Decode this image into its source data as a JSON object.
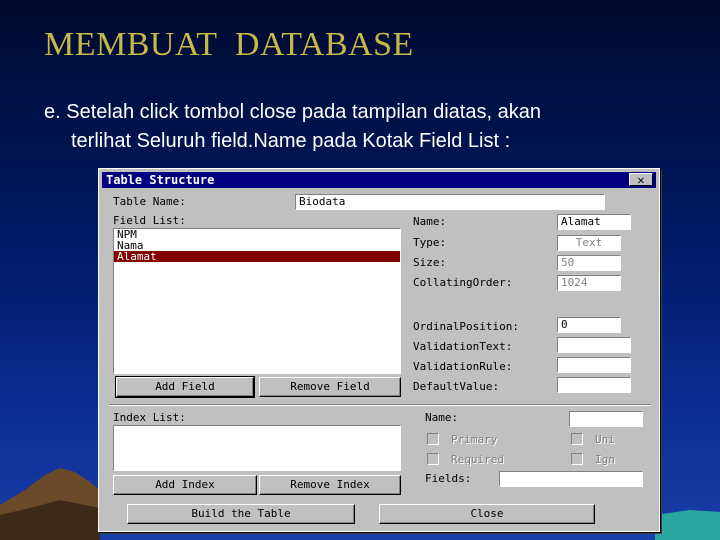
{
  "slide": {
    "title": "MEMBUAT  DATABASE",
    "text_line1": "e. Setelah click tombol close pada tampilan diatas, akan",
    "text_line2": "terlihat Seluruh field.Name pada Kotak Field List  :"
  },
  "dialog": {
    "title": "Table Structure",
    "close_glyph": "✕",
    "table_name_label": "Table Name:",
    "table_name_value": "Biodata",
    "field_list_label": "Field List:",
    "fields": [
      "NPM",
      "Nama",
      "Alamat"
    ],
    "selected_field_index": 2,
    "props": {
      "name_label": "Name:",
      "name_value": "Alamat",
      "type_label": "Type:",
      "type_value": "Text",
      "size_label": "Size:",
      "size_value": "50",
      "collating_label": "CollatingOrder:",
      "collating_value": "1024",
      "ordinal_label": "OrdinalPosition:",
      "ordinal_value": "0",
      "validation_text_label": "ValidationText:",
      "validation_text_value": "",
      "validation_rule_label": "ValidationRule:",
      "validation_rule_value": "",
      "default_value_label": "DefaultValue:",
      "default_value_value": ""
    },
    "add_field_label": "Add Field",
    "remove_field_label": "Remove Field",
    "index_list_label": "Index List:",
    "index": {
      "name_label": "Name:",
      "name_value": "",
      "primary_label": "Primary",
      "unique_label": "Uni",
      "required_label": "Required",
      "ignore_label": "Ign",
      "fields_label": "Fields:",
      "fields_value": ""
    },
    "add_index_label": "Add Index",
    "remove_index_label": "Remove Index",
    "build_label": "Build the Table",
    "close_label": "Close"
  },
  "colors": {
    "title_color": "#c8b845",
    "titlebar": "#000080",
    "selection": "#800000"
  }
}
